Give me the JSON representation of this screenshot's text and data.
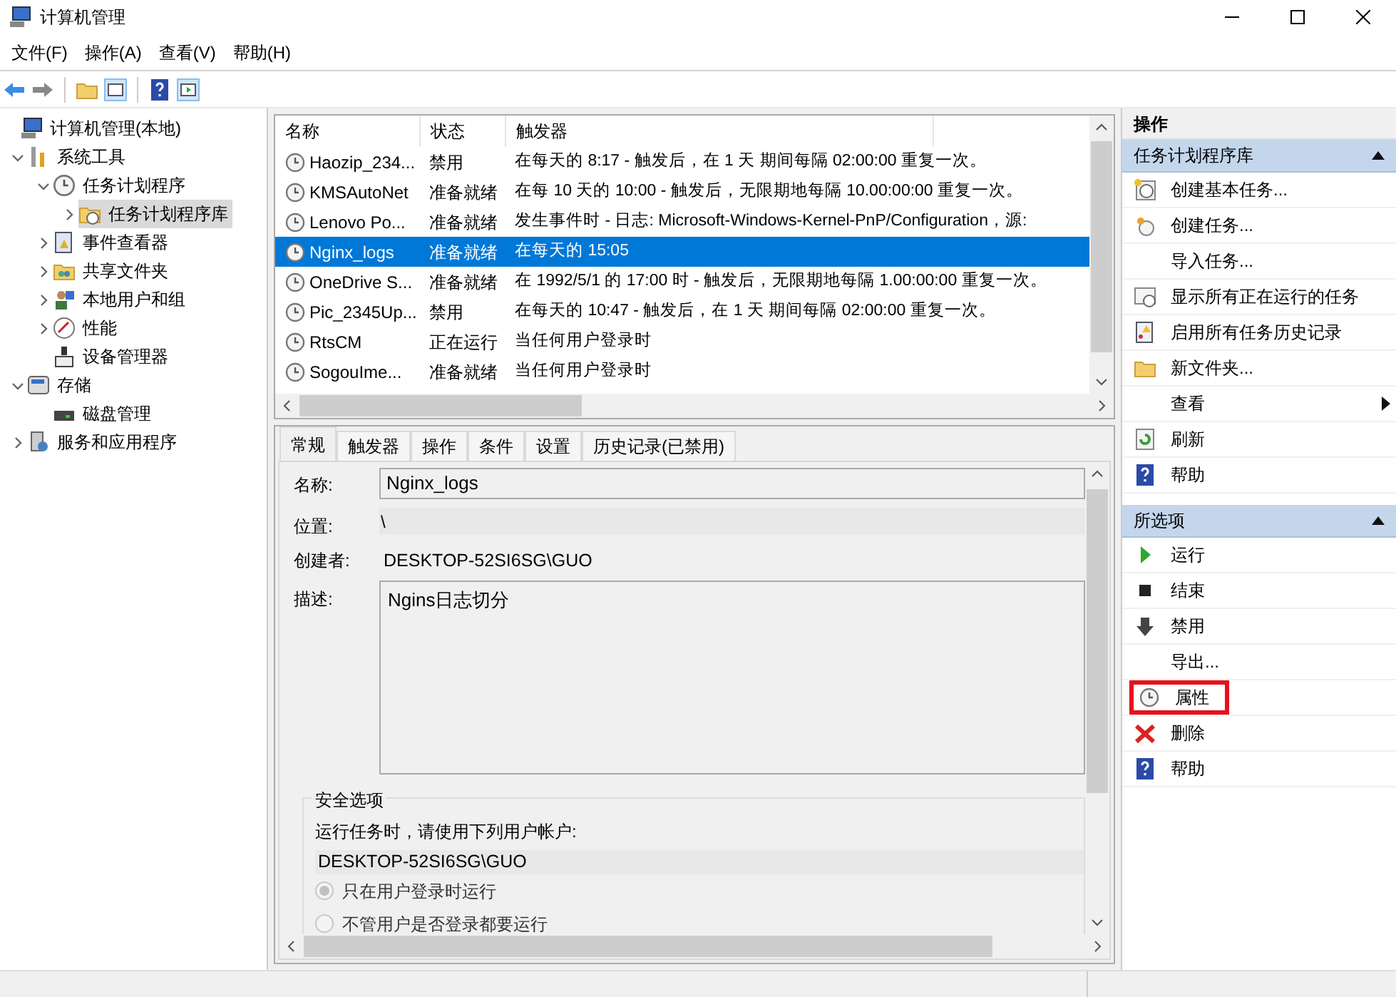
{
  "window": {
    "title": "计算机管理"
  },
  "menu": [
    "文件(F)",
    "操作(A)",
    "查看(V)",
    "帮助(H)"
  ],
  "tree": [
    {
      "label": "计算机管理(本地)",
      "selected": false,
      "children": [
        {
          "label": "系统工具",
          "expanded": true,
          "selected": false,
          "children": [
            {
              "label": "任务计划程序",
              "expanded": true,
              "selected": false,
              "children": [
                {
                  "label": "任务计划程序库",
                  "expanded": false,
                  "selected": true
                }
              ]
            },
            {
              "label": "事件查看器",
              "expanded": false,
              "selected": false
            },
            {
              "label": "共享文件夹",
              "expanded": false,
              "selected": false
            },
            {
              "label": "本地用户和组",
              "expanded": false,
              "selected": false
            },
            {
              "label": "性能",
              "expanded": false,
              "selected": false
            },
            {
              "label": "设备管理器",
              "selected": false
            }
          ]
        },
        {
          "label": "存储",
          "expanded": true,
          "selected": false,
          "children": [
            {
              "label": "磁盘管理",
              "selected": false
            }
          ]
        },
        {
          "label": "服务和应用程序",
          "expanded": false,
          "selected": false
        }
      ]
    }
  ],
  "tasks": {
    "columns": [
      "名称",
      "状态",
      "触发器"
    ],
    "rows": [
      {
        "name": "Haozip_234...",
        "status": "禁用",
        "trigger": "在每天的 8:17 - 触发后，在 1 天 期间每隔 02:00:00 重复一次。",
        "selected": false
      },
      {
        "name": "KMSAutoNet",
        "status": "准备就绪",
        "trigger": "在每 10 天的 10:00 - 触发后，无限期地每隔 10.00:00:00 重复一次。",
        "selected": false
      },
      {
        "name": "Lenovo Po...",
        "status": "准备就绪",
        "trigger": "发生事件时 - 日志: Microsoft-Windows-Kernel-PnP/Configuration，源:",
        "selected": false
      },
      {
        "name": "Nginx_logs",
        "status": "准备就绪",
        "trigger": "在每天的 15:05",
        "selected": true
      },
      {
        "name": "OneDrive S...",
        "status": "准备就绪",
        "trigger": "在 1992/5/1 的 17:00 时 - 触发后，无限期地每隔 1.00:00:00 重复一次。",
        "selected": false
      },
      {
        "name": "Pic_2345Up...",
        "status": "禁用",
        "trigger": "在每天的 10:47 - 触发后，在 1 天 期间每隔 02:00:00 重复一次。",
        "selected": false
      },
      {
        "name": "RtsCM",
        "status": "正在运行",
        "trigger": "当任何用户登录时",
        "selected": false
      },
      {
        "name": "SogouIme...",
        "status": "准备就绪",
        "trigger": "当任何用户登录时",
        "selected": false
      }
    ]
  },
  "detail": {
    "tabs": [
      {
        "label": "常规",
        "selected": true
      },
      {
        "label": "触发器",
        "selected": false
      },
      {
        "label": "操作",
        "selected": false
      },
      {
        "label": "条件",
        "selected": false
      },
      {
        "label": "设置",
        "selected": false
      },
      {
        "label": "历史记录(已禁用)",
        "selected": false
      }
    ],
    "name_label": "名称:",
    "name": "Nginx_logs",
    "location_label": "位置:",
    "location": "\\",
    "author_label": "创建者:",
    "author": "DESKTOP-52SI6SG\\GUO",
    "description_label": "描述:",
    "description": "Ngins日志切分",
    "security": {
      "title": "安全选项",
      "prompt": "运行任务时，请使用下列用户帐户:",
      "account": "DESKTOP-52SI6SG\\GUO",
      "options": [
        {
          "label": "只在用户登录时运行",
          "selected": true
        },
        {
          "label": "不管用户是否登录都要运行",
          "selected": false
        }
      ]
    }
  },
  "actions": {
    "title": "操作",
    "sections": [
      {
        "title": "任务计划程序库",
        "expanded": true,
        "items": [
          {
            "label": "创建基本任务...",
            "submenu": false,
            "highlighted": false
          },
          {
            "label": "创建任务...",
            "submenu": false,
            "highlighted": false
          },
          {
            "label": "导入任务...",
            "submenu": false,
            "highlighted": false
          },
          {
            "label": "显示所有正在运行的任务",
            "submenu": false,
            "highlighted": false
          },
          {
            "label": "启用所有任务历史记录",
            "submenu": false,
            "highlighted": false
          },
          {
            "label": "新文件夹...",
            "submenu": false,
            "highlighted": false
          },
          {
            "label": "查看",
            "submenu": true,
            "highlighted": false
          },
          {
            "label": "刷新",
            "submenu": false,
            "highlighted": false
          },
          {
            "label": "帮助",
            "submenu": false,
            "highlighted": false
          }
        ]
      },
      {
        "title": "所选项",
        "expanded": true,
        "items": [
          {
            "label": "运行",
            "submenu": false,
            "highlighted": false
          },
          {
            "label": "结束",
            "submenu": false,
            "highlighted": false
          },
          {
            "label": "禁用",
            "submenu": false,
            "highlighted": false
          },
          {
            "label": "导出...",
            "submenu": false,
            "highlighted": false
          },
          {
            "label": "属性",
            "submenu": false,
            "highlighted": true
          },
          {
            "label": "删除",
            "submenu": false,
            "highlighted": false
          },
          {
            "label": "帮助",
            "submenu": false,
            "highlighted": false
          }
        ]
      }
    ]
  }
}
